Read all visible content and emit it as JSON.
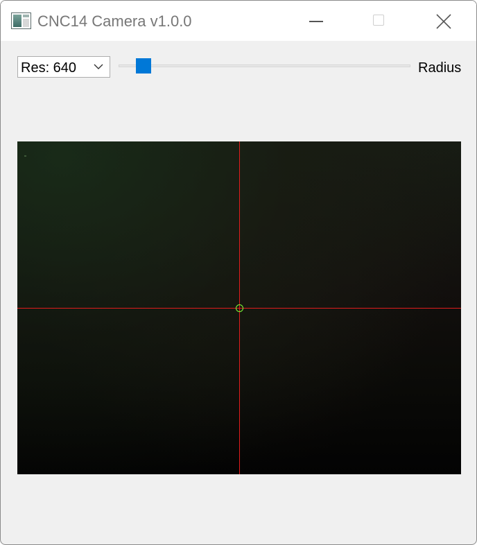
{
  "window": {
    "title": "CNC14 Camera v1.0.0"
  },
  "title_bar": {
    "app_icon": "app-window-icon",
    "minimize_icon": "minimize-icon",
    "maximize_icon": "maximize-icon",
    "close_icon": "close-icon"
  },
  "toolbar": {
    "resolution_select": {
      "value": "Res: 640",
      "icon": "chevron-down-icon"
    },
    "radius_slider": {
      "value_fraction": 0.085
    },
    "radius_label": "Radius"
  },
  "camera_view": {
    "crosshair_color": "#e11d1d",
    "center_circle_color": "#7dff3a",
    "background_color": "#0d0d0a"
  },
  "colors": {
    "accent": "#0078d7",
    "window_bg": "#f0f0f0"
  }
}
